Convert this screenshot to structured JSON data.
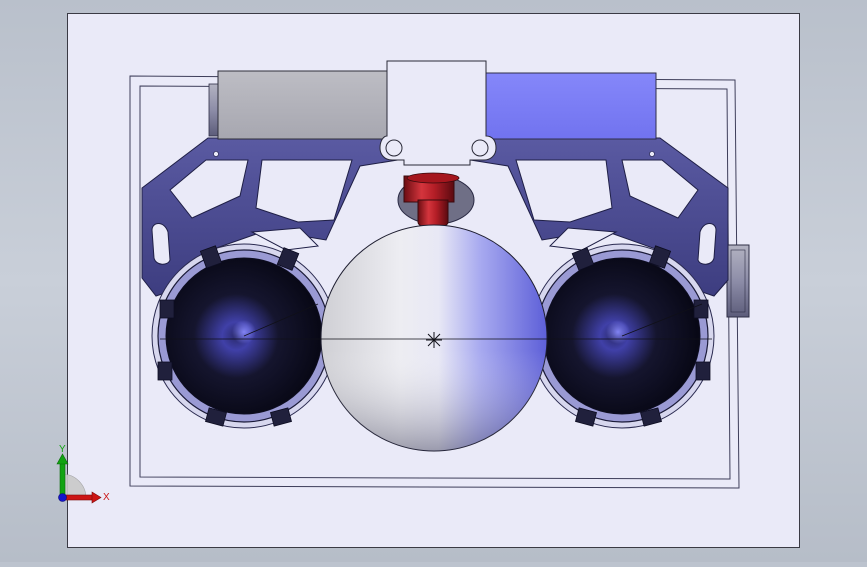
{
  "viewport": {
    "triad": {
      "x_label": "X",
      "y_label": "Y"
    }
  },
  "colors": {
    "background": "#c3c9d3",
    "sheet": "#eaeaf8",
    "frame": "#4a4a6e",
    "bracket": "#4f4f95",
    "bracket_dark": "#2f2f66",
    "block_gray": "#b0b0b8",
    "block_blue": "#7c7ef6",
    "pipe_red": "#c01f28",
    "axis_x": "#cc1010",
    "axis_y": "#10a010",
    "axis_z": "#1010cc"
  }
}
